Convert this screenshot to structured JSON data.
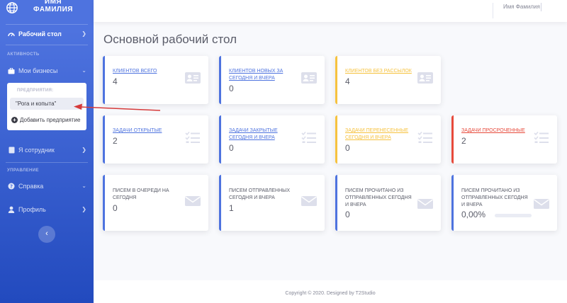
{
  "sidebar": {
    "brand_line1": "ИМЯ",
    "brand_line2": "ФАМИЛИЯ",
    "dashboard": "Рабочий стол",
    "heading_activity": "АКТИВНОСТЬ",
    "my_business": "Мои бизнесы",
    "submenu_heading": "ПРЕДПРИЯТИЯ:",
    "submenu_item": "\"Рога и копыта\"",
    "submenu_add": "Добавить предприятие",
    "employee": "Я сотрудник",
    "heading_management": "УПРАВЛЕНИЕ",
    "help": "Справка",
    "profile": "Профиль",
    "toggle_icon": "‹"
  },
  "topbar": {
    "user_name": "Имя Фамилия"
  },
  "page_title": "Основной рабочий стол",
  "cards": {
    "clients_total": {
      "label": "КЛИЕНТОВ ВСЕГО",
      "value": "4"
    },
    "clients_new": {
      "label": "КЛИЕНТОВ НОВЫХ ЗА СЕГОДНЯ И ВЧЕРА",
      "value": "0"
    },
    "clients_nomail": {
      "label": "КЛИЕНТОВ БЕЗ РАССЫЛОК",
      "value": "4"
    },
    "tasks_open": {
      "label": "ЗАДАЧИ ОТКРЫТЫЕ",
      "value": "2"
    },
    "tasks_closed": {
      "label": "ЗАДАЧИ ЗАКРЫТЫЕ СЕГОДНЯ И ВЧЕРА",
      "value": "0"
    },
    "tasks_moved": {
      "label": "ЗАДАЧИ ПЕРЕНЕСЕННЫЕ СЕГОДНЯ И ВЧЕРА",
      "value": "0"
    },
    "tasks_overdue": {
      "label": "ЗАДАЧИ ПРОСРОЧЕННЫЕ",
      "value": "2"
    },
    "mail_queue": {
      "label": "ПИСЕМ В ОЧЕРЕДИ НА СЕГОДНЯ",
      "value": "0"
    },
    "mail_sent": {
      "label": "ПИСЕМ ОТПРАВЛЕННЫХ СЕГОДНЯ И ВЧЕРА",
      "value": "1"
    },
    "mail_read": {
      "label": "ПИСЕМ ПРОЧИТАНО ИЗ ОТПРАВЛЕННЫХ СЕГОДНЯ И ВЧЕРА",
      "value": "0"
    },
    "mail_read_pct": {
      "label": "ПИСЕМ ПРОЧИТАНО ИЗ ОТПРАВЛЕННЫХ СЕГОДНЯ И ВЧЕРА",
      "value": "0,00%",
      "progress_fraction": 0
    }
  },
  "footer": "Copyright © 2020. Designed by T2Studio",
  "colors": {
    "primary": "#4e73df",
    "warning": "#f6c23e",
    "danger": "#e74a3b",
    "icon_gray": "#dddfeb",
    "annotation_arrow": "#d63a3a"
  }
}
